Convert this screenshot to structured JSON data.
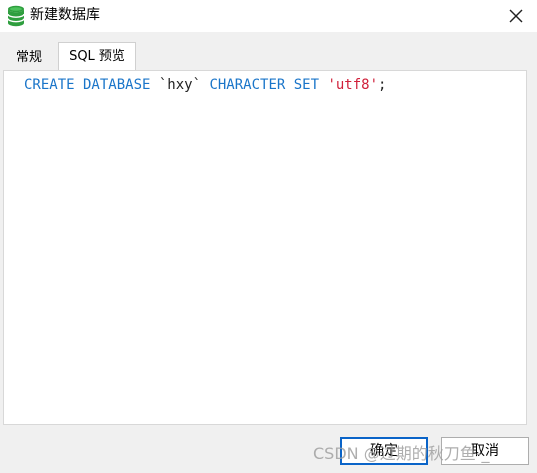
{
  "window": {
    "title": "新建数据库"
  },
  "tabs": [
    {
      "label": "常规",
      "active": false
    },
    {
      "label": "SQL 预览",
      "active": true
    }
  ],
  "sql_preview": {
    "tokens": [
      {
        "text": "CREATE DATABASE ",
        "kind": "keyword"
      },
      {
        "text": "`hxy` ",
        "kind": "identifier"
      },
      {
        "text": "CHARACTER SET ",
        "kind": "keyword"
      },
      {
        "text": "'utf8'",
        "kind": "string"
      },
      {
        "text": ";",
        "kind": "identifier"
      }
    ],
    "colors": {
      "keyword": "#1a75c9",
      "identifier": "#222222",
      "string": "#d0203a"
    }
  },
  "buttons": {
    "ok_label": "确定",
    "cancel_label": "取消"
  },
  "watermark": "CSDN @过期的秋刀鱼-_",
  "icons": {
    "app": "database-icon",
    "close": "close-icon"
  }
}
